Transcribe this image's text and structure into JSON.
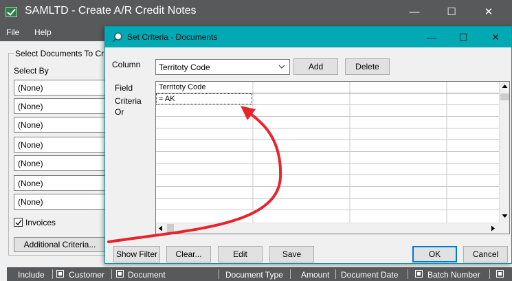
{
  "main_window": {
    "title": "SAMLTD - Create A/R Credit Notes",
    "controls": {
      "minimize": "—",
      "maximize": "☐",
      "close": "✕"
    },
    "menu": [
      "File",
      "Help"
    ],
    "group_label": "Select Documents To Cr",
    "select_by_label": "Select By",
    "select_by_values": [
      "(None)",
      "(None)",
      "(None)",
      "(None)",
      "(None)",
      "(None)",
      "(None)"
    ],
    "invoices_label": "Invoices",
    "invoices_checked": true,
    "additional_criteria_label": "Additional Criteria...",
    "grid_columns": [
      "Include",
      "Customer",
      "Document",
      "Document Type",
      "Amount",
      "Document Date",
      "Batch Number"
    ]
  },
  "dialog": {
    "title": "Set Criteria - Documents",
    "controls": {
      "minimize": "—",
      "maximize": "☐",
      "close": "✕"
    },
    "column_label": "Column",
    "column_value": "Territoty Code",
    "add_label": "Add",
    "delete_label": "Delete",
    "field_label": "Field",
    "criteria_label": "Criteria",
    "or_label": "Or",
    "grid_header": "Territoty Code",
    "grid_criteria_value": "= AK",
    "buttons": {
      "show_filter": "Show Filter",
      "clear": "Clear...",
      "edit": "Edit",
      "save": "Save",
      "ok": "OK",
      "cancel": "Cancel"
    }
  },
  "colors": {
    "main_titlebar": "#58595b",
    "dialog_titlebar": "#00a9b4",
    "annotation_arrow": "#e8242b"
  },
  "icons": {
    "app": "check-icon",
    "dialog": "search-icon",
    "header": "grid-header-icon"
  }
}
